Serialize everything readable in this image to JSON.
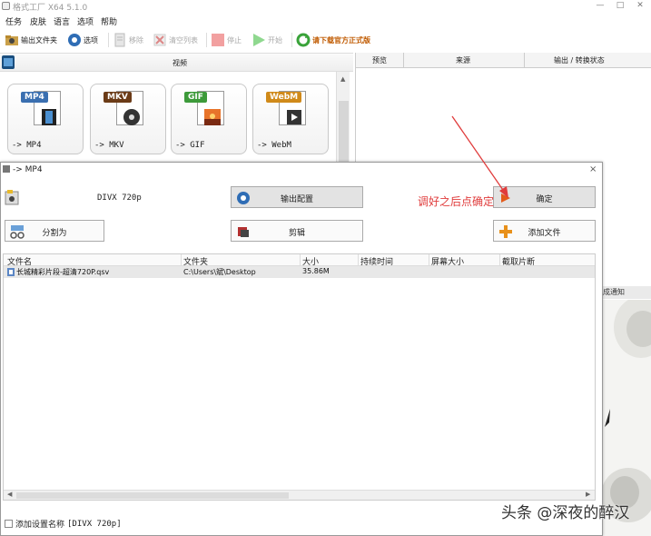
{
  "app": {
    "title": "格式工厂 X64 5.1.0",
    "window_controls": [
      "—",
      "□",
      "✕"
    ]
  },
  "menu": [
    "任务",
    "皮肤",
    "语言",
    "选项",
    "帮助"
  ],
  "toolbar": {
    "output_folder": "输出文件夹",
    "options": "选项",
    "remove": "移除",
    "clear_list": "清空列表",
    "stop": "停止",
    "start": "开始",
    "download_promo": "请下载官方正式版"
  },
  "video_panel": {
    "header": "视频",
    "formats": [
      {
        "tag": "MP4",
        "caption": "-> MP4",
        "color": "#3a6fb0"
      },
      {
        "tag": "MKV",
        "caption": "-> MKV",
        "color": "#6b3b17"
      },
      {
        "tag": "GIF",
        "caption": "-> GIF",
        "color": "#3d9a3a"
      },
      {
        "tag": "WebM",
        "caption": "-> WebM",
        "color": "#d08a1a"
      }
    ]
  },
  "task_list": {
    "columns": [
      "预览",
      "来源",
      "输出 / 转换状态"
    ],
    "status_fragment": "成通知"
  },
  "dialog": {
    "title": "-> MP4",
    "close": "×",
    "preset": "DIVX 720p",
    "output_config": "输出配置",
    "ok": "确定",
    "split": "分割为",
    "edit": "剪辑",
    "add_file": "添加文件",
    "annotation": "调好之后点确定",
    "table": {
      "columns": [
        "文件名",
        "文件夹",
        "大小",
        "持续时间",
        "屏幕大小",
        "截取片断"
      ],
      "rows": [
        {
          "name": "长城精彩片段-超清720P.qsv",
          "folder": "C:\\Users\\斌\\Desktop",
          "size": "35.86M",
          "duration": "",
          "screen": "",
          "clip": ""
        }
      ]
    },
    "save_label": "添加设置名称",
    "save_value": "[DIVX 720p]"
  },
  "watermark": "头条 @深夜的醉汉",
  "colors": {
    "accent_red": "#e03c3c",
    "promo_orange": "#c05a00"
  }
}
